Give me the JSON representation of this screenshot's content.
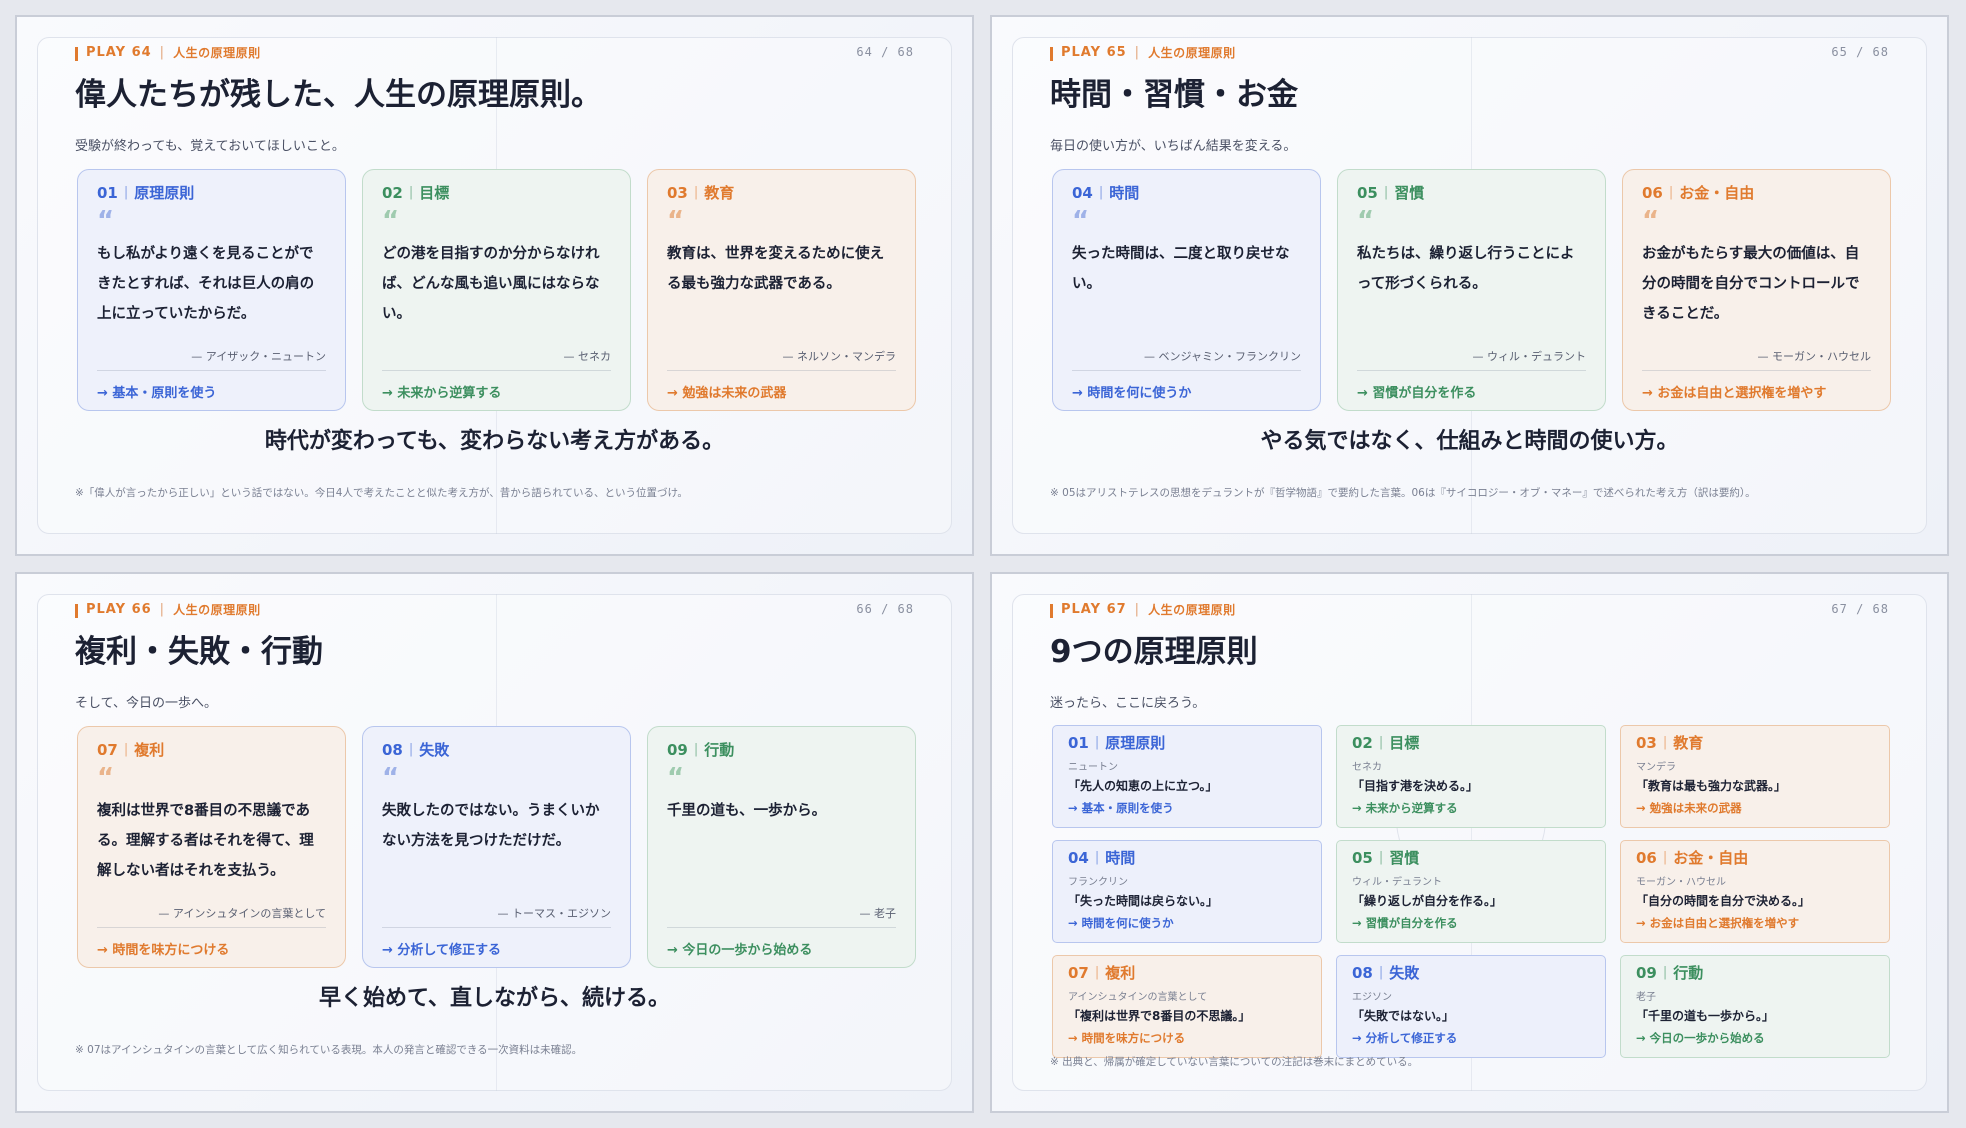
{
  "slides": [
    {
      "play": "PLAY 64",
      "section": "人生の原理原則",
      "page": "64 / 68",
      "title": "偉人たちが残した、人生の原理原則。",
      "subtitle": "受験が終わっても、覚えておいてほしいこと。",
      "cards": [
        {
          "num": "01",
          "label": "原理原則",
          "quote": "もし私がより遠くを見ることができたとすれば、それは巨人の肩の上に立っていたからだ。",
          "author": "— アイザック・ニュートン",
          "takeaway": "→ 基本・原則を使う"
        },
        {
          "num": "02",
          "label": "目標",
          "quote": "どの港を目指すのか分からなければ、どんな風も追い風にはならない。",
          "author": "— セネカ",
          "takeaway": "→ 未来から逆算する"
        },
        {
          "num": "03",
          "label": "教育",
          "quote": "教育は、世界を変えるために使える最も強力な武器である。",
          "author": "— ネルソン・マンデラ",
          "takeaway": "→ 勉強は未来の武器"
        }
      ],
      "statement": "時代が変わっても、変わらない考え方がある。",
      "note": "※「偉人が言ったから正しい」という話ではない。今日4人で考えたことと似た考え方が、昔から語られている、という位置づけ。"
    },
    {
      "play": "PLAY 65",
      "section": "人生の原理原則",
      "page": "65 / 68",
      "title": "時間・習慣・お金",
      "subtitle": "毎日の使い方が、いちばん結果を変える。",
      "cards": [
        {
          "num": "04",
          "label": "時間",
          "quote": "失った時間は、二度と取り戻せない。",
          "author": "— ベンジャミン・フランクリン",
          "takeaway": "→ 時間を何に使うか"
        },
        {
          "num": "05",
          "label": "習慣",
          "quote": "私たちは、繰り返し行うことによって形づくられる。",
          "author": "— ウィル・デュラント",
          "takeaway": "→ 習慣が自分を作る"
        },
        {
          "num": "06",
          "label": "お金・自由",
          "quote": "お金がもたらす最大の価値は、自分の時間を自分でコントロールできることだ。",
          "author": "— モーガン・ハウセル",
          "takeaway": "→ お金は自由と選択権を増やす"
        }
      ],
      "statement": "やる気ではなく、仕組みと時間の使い方。",
      "note": "※ 05はアリストテレスの思想をデュラントが『哲学物語』で要約した言葉。06は『サイコロジー・オブ・マネー』で述べられた考え方（訳は要約）。"
    },
    {
      "play": "PLAY 66",
      "section": "人生の原理原則",
      "page": "66 / 68",
      "title": "複利・失敗・行動",
      "subtitle": "そして、今日の一歩へ。",
      "cards": [
        {
          "num": "07",
          "label": "複利",
          "quote": "複利は世界で8番目の不思議である。理解する者はそれを得て、理解しない者はそれを支払う。",
          "author": "— アインシュタインの言葉として",
          "takeaway": "→ 時間を味方につける"
        },
        {
          "num": "08",
          "label": "失敗",
          "quote": "失敗したのではない。うまくいかない方法を見つけただけだ。",
          "author": "— トーマス・エジソン",
          "takeaway": "→ 分析して修正する"
        },
        {
          "num": "09",
          "label": "行動",
          "quote": "千里の道も、一歩から。",
          "author": "— 老子",
          "takeaway": "→ 今日の一歩から始める"
        }
      ],
      "statement": "早く始めて、直しながら、続ける。",
      "note": "※ 07はアインシュタインの言葉として広く知られている表現。本人の発言と確認できる一次資料は未確認。"
    },
    {
      "play": "PLAY 67",
      "section": "人生の原理原則",
      "page": "67 / 68",
      "title": "9つの原理原則",
      "subtitle": "迷ったら、ここに戻ろう。",
      "items": [
        {
          "num": "01",
          "label": "原理原則",
          "who": "ニュートン",
          "quote": "「先人の知恵の上に立つ。」",
          "takeaway": "→ 基本・原則を使う"
        },
        {
          "num": "02",
          "label": "目標",
          "who": "セネカ",
          "quote": "「目指す港を決める。」",
          "takeaway": "→ 未来から逆算する"
        },
        {
          "num": "03",
          "label": "教育",
          "who": "マンデラ",
          "quote": "「教育は最も強力な武器。」",
          "takeaway": "→ 勉強は未来の武器"
        },
        {
          "num": "04",
          "label": "時間",
          "who": "フランクリン",
          "quote": "「失った時間は戻らない。」",
          "takeaway": "→ 時間を何に使うか"
        },
        {
          "num": "05",
          "label": "習慣",
          "who": "ウィル・デュラント",
          "quote": "「繰り返しが自分を作る。」",
          "takeaway": "→ 習慣が自分を作る"
        },
        {
          "num": "06",
          "label": "お金・自由",
          "who": "モーガン・ハウセル",
          "quote": "「自分の時間を自分で決める。」",
          "takeaway": "→ お金は自由と選択権を増やす"
        },
        {
          "num": "07",
          "label": "複利",
          "who": "アインシュタインの言葉として",
          "quote": "「複利は世界で8番目の不思議。」",
          "takeaway": "→ 時間を味方につける"
        },
        {
          "num": "08",
          "label": "失敗",
          "who": "エジソン",
          "quote": "「失敗ではない。」",
          "takeaway": "→ 分析して修正する"
        },
        {
          "num": "09",
          "label": "行動",
          "who": "老子",
          "quote": "「千里の道も一歩から。」",
          "takeaway": "→ 今日の一歩から始める"
        }
      ],
      "note": "※ 出典と、帰属が確定していない言葉についての注記は巻末にまとめている。"
    }
  ],
  "colors": {
    "blue": "#3b65d6",
    "green": "#3c8f5f",
    "orange": "#e07a2e"
  }
}
